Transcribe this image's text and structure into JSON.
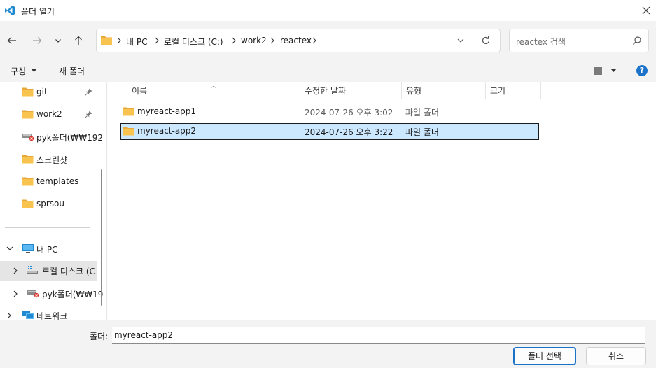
{
  "window": {
    "title": "폴더 열기"
  },
  "nav": {
    "breadcrumbs": [
      "내 PC",
      "로컬 디스크 (C:)",
      "work2",
      "reactex"
    ],
    "search_placeholder": "reactex 검색"
  },
  "toolbar": {
    "organize_label": "구성",
    "new_folder_label": "새 폴더"
  },
  "sidebar": {
    "quick_access": [
      {
        "label": "git",
        "pinned": true
      },
      {
        "label": "work2",
        "pinned": true
      },
      {
        "label": "pyk폴더(₩₩192",
        "pinned": false
      },
      {
        "label": "스크린샷",
        "pinned": false
      },
      {
        "label": "templates",
        "pinned": false
      },
      {
        "label": "sprsou",
        "pinned": false
      }
    ],
    "tree": [
      {
        "label": "내 PC",
        "expanded": true
      },
      {
        "label": "로컬 디스크 (C",
        "selected": true
      },
      {
        "label": "pyk폴더(₩₩19"
      },
      {
        "label": "네트워크"
      }
    ]
  },
  "files": {
    "columns": [
      "이름",
      "수정한 날짜",
      "유형",
      "크기"
    ],
    "rows": [
      {
        "name": "myreact-app1",
        "date": "2024-07-26 오후 3:02",
        "type": "파일 폴더",
        "selected": false
      },
      {
        "name": "myreact-app2",
        "date": "2024-07-26 오후 3:22",
        "type": "파일 폴더",
        "selected": true
      }
    ]
  },
  "footer": {
    "folder_label": "폴더:",
    "folder_value": "myreact-app2",
    "select_button": "폴더 선택",
    "cancel_button": "취소"
  },
  "colors": {
    "accent": "#1a73c8",
    "selection": "#cce8ff",
    "folder": "#f8c44f",
    "chrome": "#f3f3f3"
  },
  "icons": [
    "vscode-icon",
    "close-icon",
    "back-arrow-icon",
    "forward-arrow-icon",
    "recent-dropdown-icon",
    "up-arrow-icon",
    "folder-icon",
    "refresh-icon",
    "search-icon",
    "pin-icon",
    "view-list-icon",
    "help-icon",
    "computer-icon",
    "drive-icon",
    "network-drive-icon",
    "network-icon"
  ]
}
